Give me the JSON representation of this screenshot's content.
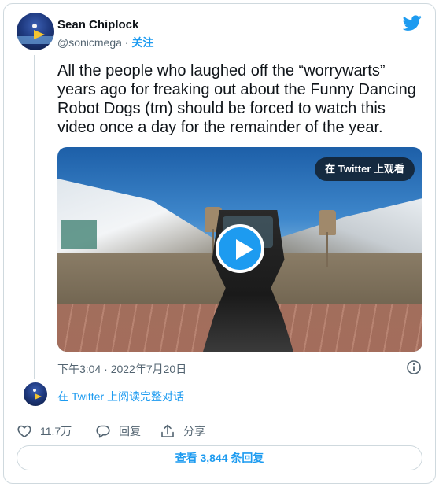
{
  "author": {
    "name": "Sean Chiplock",
    "handle": "@sonicmega",
    "separator": " · ",
    "follow_label": "关注"
  },
  "tweet": {
    "text": "All the people who laughed off the “worrywarts” years ago for freaking out about the Funny Dancing Robot Dogs (tm) should be forced to watch this video once a day for the remainder of the year."
  },
  "media": {
    "watch_label": "在 Twitter 上观看"
  },
  "meta": {
    "timestamp": "下午3:04 · 2022年7月20日"
  },
  "conversation": {
    "read_label": "在 Twitter 上阅读完整对话"
  },
  "actions": {
    "likes_count": "11.7万",
    "reply_label": "回复",
    "share_label": "分享"
  },
  "replies": {
    "button_label": "查看 3,844 条回复"
  },
  "colors": {
    "accent": "#1d9bf0",
    "text": "#0f1419",
    "secondary": "#536471",
    "border": "#cfd9de"
  }
}
